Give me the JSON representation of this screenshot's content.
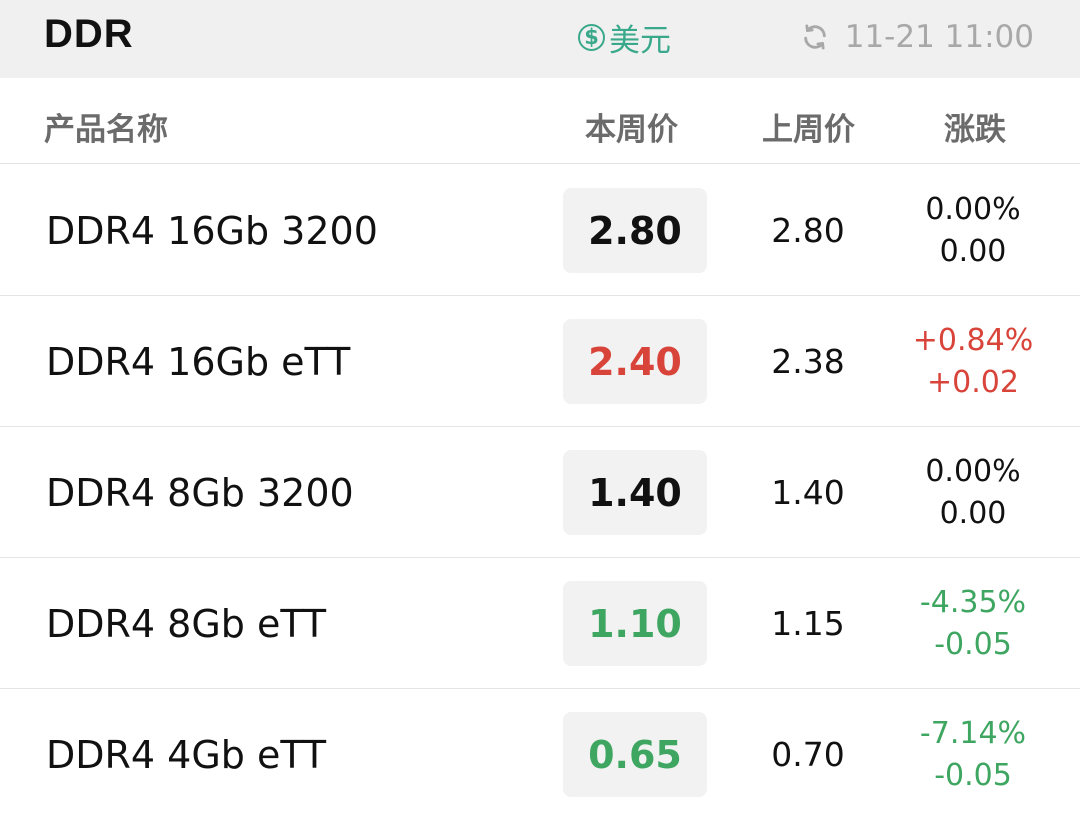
{
  "header": {
    "title": "DDR",
    "currency_label": "美元",
    "currency_icon": "$",
    "update_time": "11-21 11:00"
  },
  "columns": {
    "name": "产品名称",
    "this_week": "本周价",
    "last_week": "上周价",
    "change": "涨跌"
  },
  "colors": {
    "up": "#d9443a",
    "down": "#3ea661",
    "neutral": "#111111",
    "accent": "#3aa88a"
  },
  "rows": [
    {
      "name": "DDR4 16Gb 3200",
      "this_week": "2.80",
      "last_week": "2.80",
      "change_pct": "0.00%",
      "change_abs": "0.00",
      "trend": "neutral"
    },
    {
      "name": "DDR4 16Gb eTT",
      "this_week": "2.40",
      "last_week": "2.38",
      "change_pct": "+0.84%",
      "change_abs": "+0.02",
      "trend": "up"
    },
    {
      "name": "DDR4 8Gb 3200",
      "this_week": "1.40",
      "last_week": "1.40",
      "change_pct": "0.00%",
      "change_abs": "0.00",
      "trend": "neutral"
    },
    {
      "name": "DDR4 8Gb eTT",
      "this_week": "1.10",
      "last_week": "1.15",
      "change_pct": "-4.35%",
      "change_abs": "-0.05",
      "trend": "down"
    },
    {
      "name": "DDR4 4Gb eTT",
      "this_week": "0.65",
      "last_week": "0.70",
      "change_pct": "-7.14%",
      "change_abs": "-0.05",
      "trend": "down"
    }
  ]
}
